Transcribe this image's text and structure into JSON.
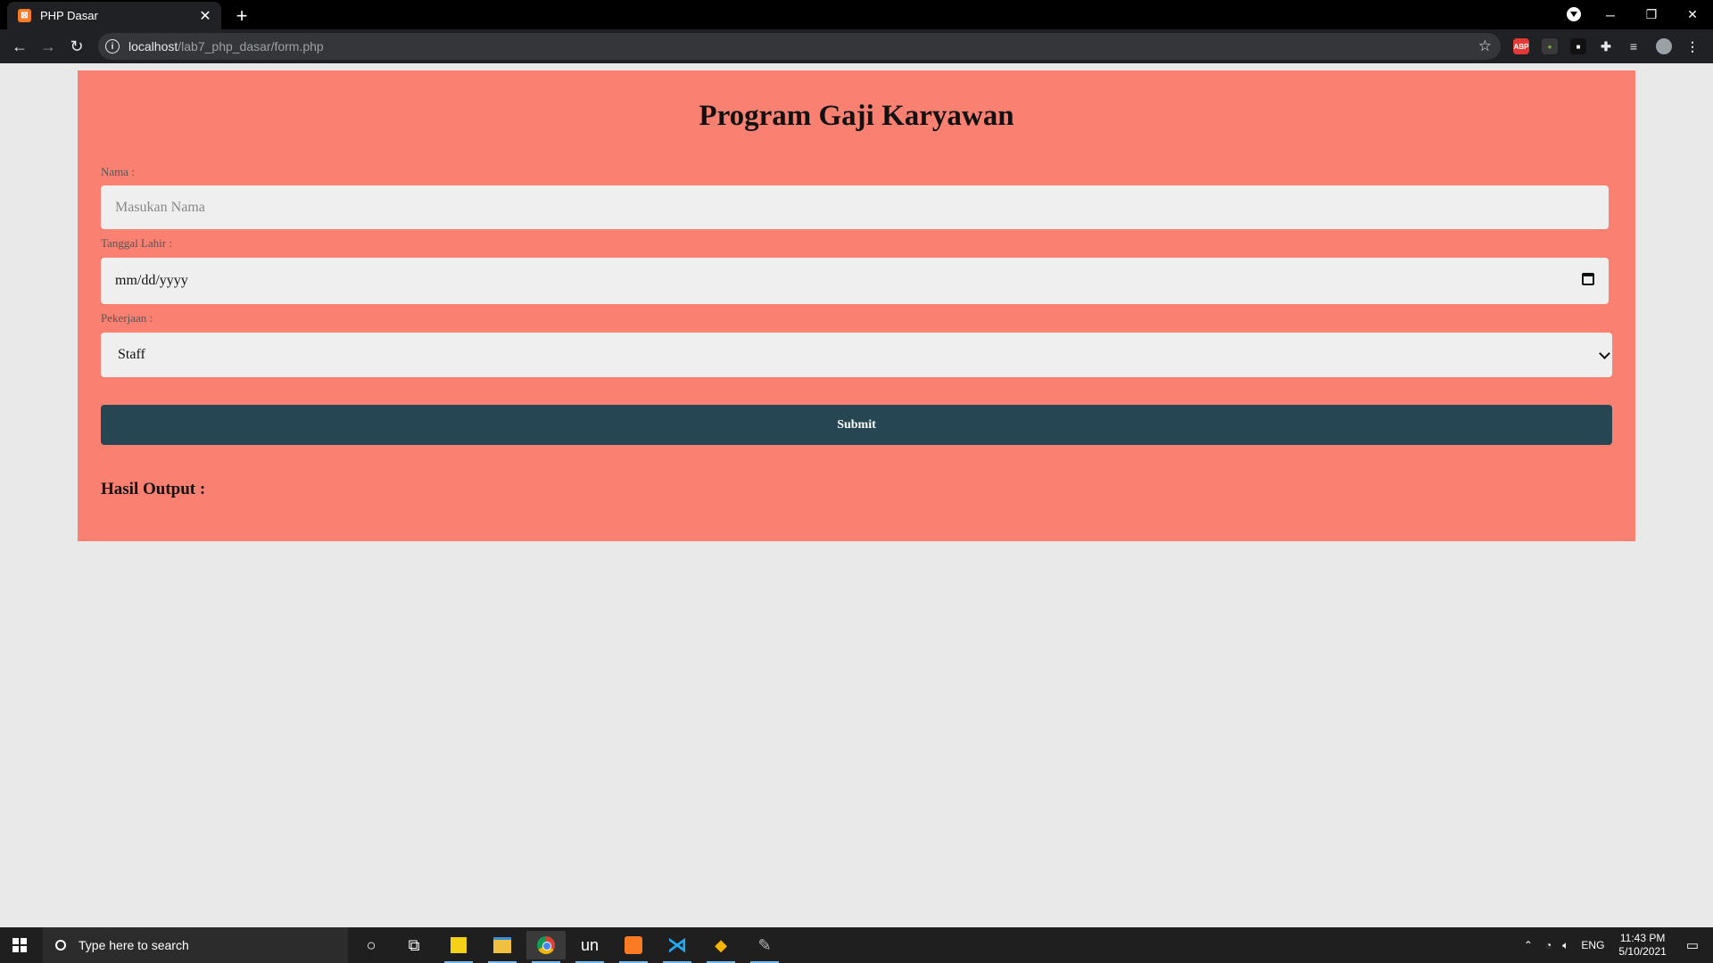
{
  "browser": {
    "tab_title": "PHP Dasar",
    "tab_favicon": "xampp-icon",
    "url_host": "localhost",
    "url_path": "/lab7_php_dasar/form.php"
  },
  "page": {
    "title": "Program Gaji Karyawan",
    "nama_label": "Nama :",
    "nama_placeholder": "Masukan Nama",
    "tanggal_label": "Tanggal Lahir :",
    "tanggal_value": "mm/dd/yyyy",
    "pekerjaan_label": "Pekerjaan :",
    "pekerjaan_selected": "Staff",
    "submit_label": "Submit",
    "output_label": "Hasil Output :",
    "colors": {
      "panel": "#fa8072",
      "button": "#264653",
      "background": "#e9e9e9"
    }
  },
  "taskbar": {
    "search_placeholder": "Type here to search",
    "un_label": "un",
    "language": "ENG",
    "time": "11:43 PM",
    "date": "5/10/2021"
  }
}
